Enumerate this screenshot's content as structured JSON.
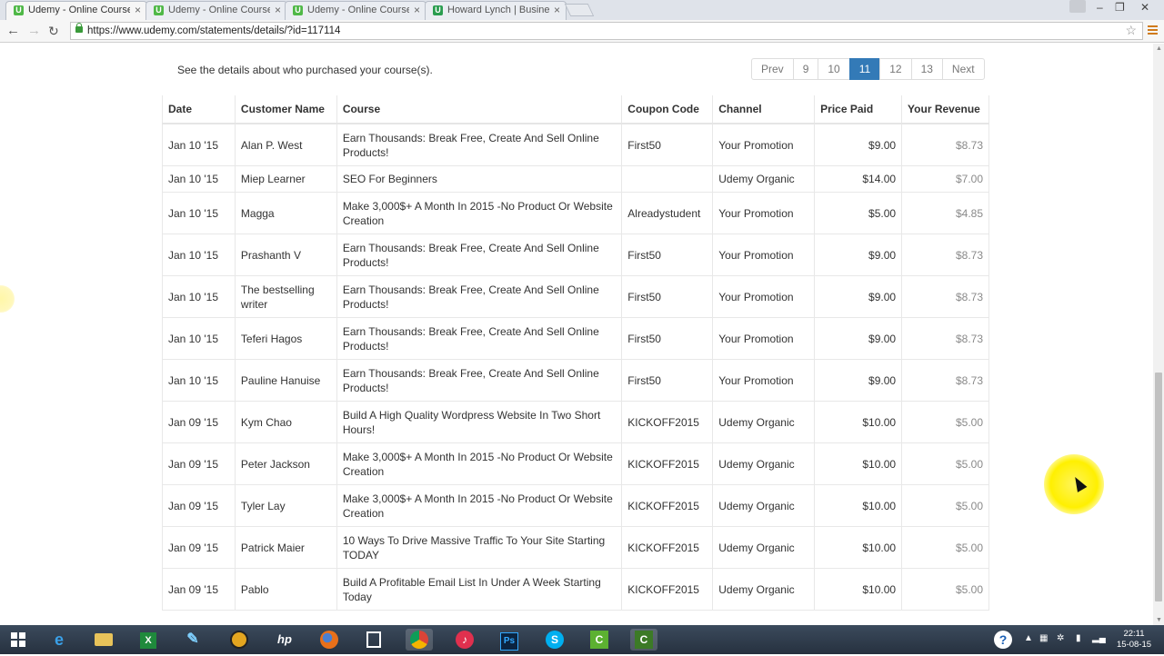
{
  "browser": {
    "tabs": [
      {
        "title": "Udemy - Online Courses f",
        "active": true
      },
      {
        "title": "Udemy - Online Courses f",
        "active": false
      },
      {
        "title": "Udemy - Online Courses f",
        "active": false
      },
      {
        "title": "Howard Lynch | Business",
        "active": false
      }
    ],
    "url": "https://www.udemy.com/statements/details/?id=117114"
  },
  "page": {
    "intro": "See the details about who purchased your course(s).",
    "pagination": [
      {
        "label": "Prev",
        "active": false
      },
      {
        "label": "9",
        "active": false
      },
      {
        "label": "10",
        "active": false
      },
      {
        "label": "11",
        "active": true
      },
      {
        "label": "12",
        "active": false
      },
      {
        "label": "13",
        "active": false
      },
      {
        "label": "Next",
        "active": false
      }
    ],
    "columns": [
      "Date",
      "Customer Name",
      "Course",
      "Coupon Code",
      "Channel",
      "Price Paid",
      "Your Revenue"
    ],
    "rows": [
      {
        "date": "Jan 10 '15",
        "customer": "Alan P. West",
        "course": "Earn Thousands: Break Free, Create And Sell Online Products!",
        "coupon": "First50",
        "channel": "Your Promotion",
        "price": "$9.00",
        "revenue": "$8.73"
      },
      {
        "date": "Jan 10 '15",
        "customer": "Miep Learner",
        "course": "SEO For Beginners",
        "coupon": "",
        "channel": "Udemy Organic",
        "price": "$14.00",
        "revenue": "$7.00"
      },
      {
        "date": "Jan 10 '15",
        "customer": "Magga",
        "course": "Make 3,000$+ A Month In 2015 -No Product Or Website Creation",
        "coupon": "Alreadystudent",
        "channel": "Your Promotion",
        "price": "$5.00",
        "revenue": "$4.85"
      },
      {
        "date": "Jan 10 '15",
        "customer": "Prashanth V",
        "course": "Earn Thousands: Break Free, Create And Sell Online Products!",
        "coupon": "First50",
        "channel": "Your Promotion",
        "price": "$9.00",
        "revenue": "$8.73"
      },
      {
        "date": "Jan 10 '15",
        "customer": "The bestselling writer",
        "course": "Earn Thousands: Break Free, Create And Sell Online Products!",
        "coupon": "First50",
        "channel": "Your Promotion",
        "price": "$9.00",
        "revenue": "$8.73"
      },
      {
        "date": "Jan 10 '15",
        "customer": "Teferi Hagos",
        "course": "Earn Thousands: Break Free, Create And Sell Online Products!",
        "coupon": "First50",
        "channel": "Your Promotion",
        "price": "$9.00",
        "revenue": "$8.73"
      },
      {
        "date": "Jan 10 '15",
        "customer": "Pauline Hanuise",
        "course": "Earn Thousands: Break Free, Create And Sell Online Products!",
        "coupon": "First50",
        "channel": "Your Promotion",
        "price": "$9.00",
        "revenue": "$8.73"
      },
      {
        "date": "Jan 09 '15",
        "customer": "Kym Chao",
        "course": "Build A High Quality Wordpress Website In Two Short Hours!",
        "coupon": "KICKOFF2015",
        "channel": "Udemy Organic",
        "price": "$10.00",
        "revenue": "$5.00"
      },
      {
        "date": "Jan 09 '15",
        "customer": "Peter Jackson",
        "course": "Make 3,000$+ A Month In 2015 -No Product Or Website Creation",
        "coupon": "KICKOFF2015",
        "channel": "Udemy Organic",
        "price": "$10.00",
        "revenue": "$5.00"
      },
      {
        "date": "Jan 09 '15",
        "customer": "Tyler Lay",
        "course": "Make 3,000$+ A Month In 2015 -No Product Or Website Creation",
        "coupon": "KICKOFF2015",
        "channel": "Udemy Organic",
        "price": "$10.00",
        "revenue": "$5.00"
      },
      {
        "date": "Jan 09 '15",
        "customer": "Patrick Maier",
        "course": "10 Ways To Drive Massive Traffic To Your Site Starting TODAY",
        "coupon": "KICKOFF2015",
        "channel": "Udemy Organic",
        "price": "$10.00",
        "revenue": "$5.00"
      },
      {
        "date": "Jan 09 '15",
        "customer": "Pablo",
        "course": "Build A Profitable Email List In Under A Week Starting Today",
        "coupon": "KICKOFF2015",
        "channel": "Udemy Organic",
        "price": "$10.00",
        "revenue": "$5.00"
      }
    ]
  },
  "taskbar": {
    "clock_time": "22:11",
    "clock_date": "15-08-15",
    "icons": [
      "windows-start-icon",
      "internet-explorer-icon",
      "file-explorer-icon",
      "excel-icon",
      "pen-tool-icon",
      "media-player-icon",
      "hp-icon",
      "firefox-icon",
      "notepad-icon",
      "chrome-icon",
      "itunes-icon",
      "photoshop-icon",
      "skype-icon",
      "camtasia-icon",
      "camtasia-recorder-icon"
    ]
  },
  "colors": {
    "accent": "#337ab7",
    "revenue_text": "#8a8a8a",
    "favicon": "#4fb847"
  }
}
